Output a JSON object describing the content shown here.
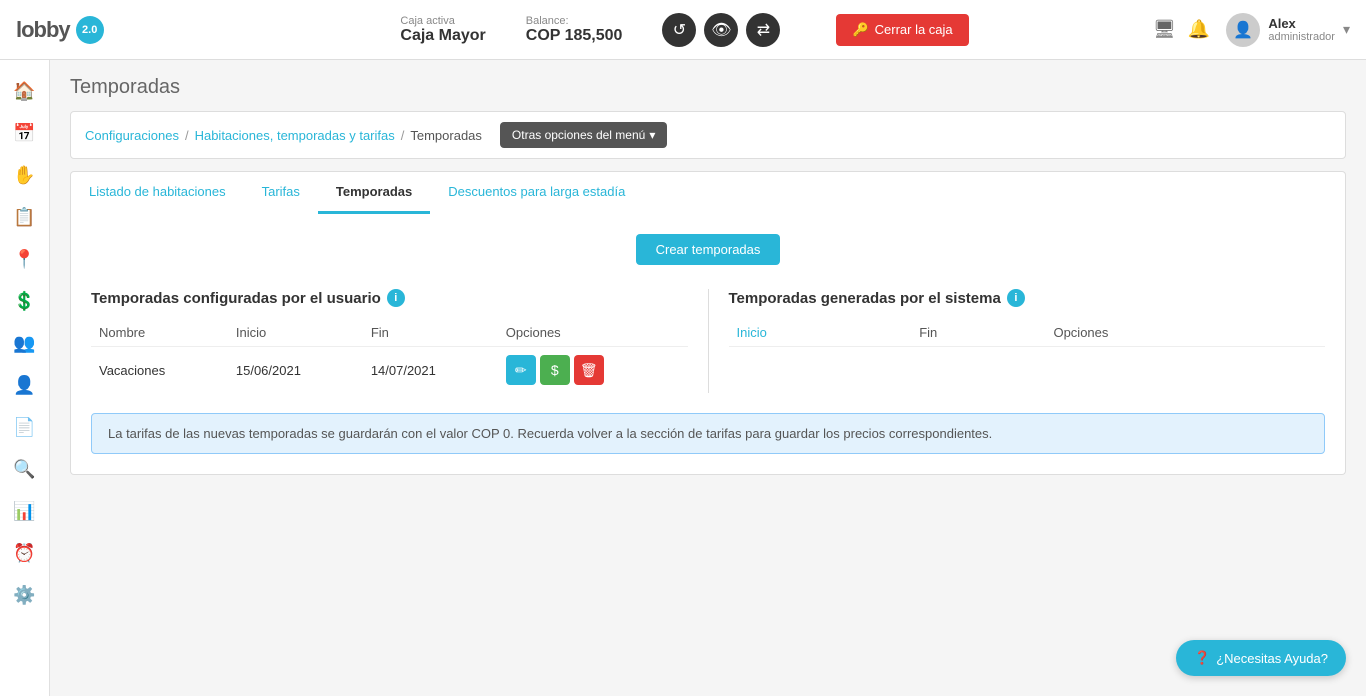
{
  "app": {
    "name": "lobby",
    "version": "2.0"
  },
  "header": {
    "caja_label": "Caja activa",
    "caja_value": "Caja Mayor",
    "balance_label": "Balance:",
    "balance_value": "COP 185,500",
    "cerrar_label": "Cerrar la caja",
    "user_name": "Alex",
    "user_role": "administrador"
  },
  "breadcrumb": {
    "items": [
      "Configuraciones",
      "Habitaciones, temporadas y tarifas",
      "Temporadas"
    ],
    "menu_label": "Otras opciones del menú"
  },
  "page": {
    "title": "Temporadas"
  },
  "tabs": [
    {
      "id": "habitaciones",
      "label": "Listado de habitaciones",
      "active": false
    },
    {
      "id": "tarifas",
      "label": "Tarifas",
      "active": false
    },
    {
      "id": "temporadas",
      "label": "Temporadas",
      "active": true
    },
    {
      "id": "descuentos",
      "label": "Descuentos para larga estadía",
      "active": false
    }
  ],
  "content": {
    "create_btn": "Crear temporadas",
    "user_seasons_title": "Temporadas configuradas por el usuario",
    "system_seasons_title": "Temporadas generadas por el sistema",
    "table_headers": [
      "Nombre",
      "Inicio",
      "Fin",
      "Opciones"
    ],
    "system_headers": [
      "Inicio",
      "Fin",
      "Opciones"
    ],
    "user_seasons": [
      {
        "nombre": "Vacaciones",
        "inicio": "15/06/2021",
        "fin": "14/07/2021"
      }
    ],
    "alert_text": "La tarifas de las nuevas temporadas se guardarán con el valor COP 0. Recuerda volver a la sección de tarifas para guardar los precios correspondientes."
  },
  "help_btn": "¿Necesitas Ayuda?",
  "sidebar": {
    "items": [
      {
        "icon": "🏠",
        "name": "home"
      },
      {
        "icon": "📅",
        "name": "calendar"
      },
      {
        "icon": "✋",
        "name": "hand"
      },
      {
        "icon": "📋",
        "name": "list"
      },
      {
        "icon": "📍",
        "name": "location"
      },
      {
        "icon": "💲",
        "name": "dollar"
      },
      {
        "icon": "👥",
        "name": "users"
      },
      {
        "icon": "👤",
        "name": "user"
      },
      {
        "icon": "📄",
        "name": "document"
      },
      {
        "icon": "🔍",
        "name": "search"
      },
      {
        "icon": "📊",
        "name": "chart"
      },
      {
        "icon": "⏰",
        "name": "clock"
      },
      {
        "icon": "⚙️",
        "name": "settings"
      }
    ]
  }
}
